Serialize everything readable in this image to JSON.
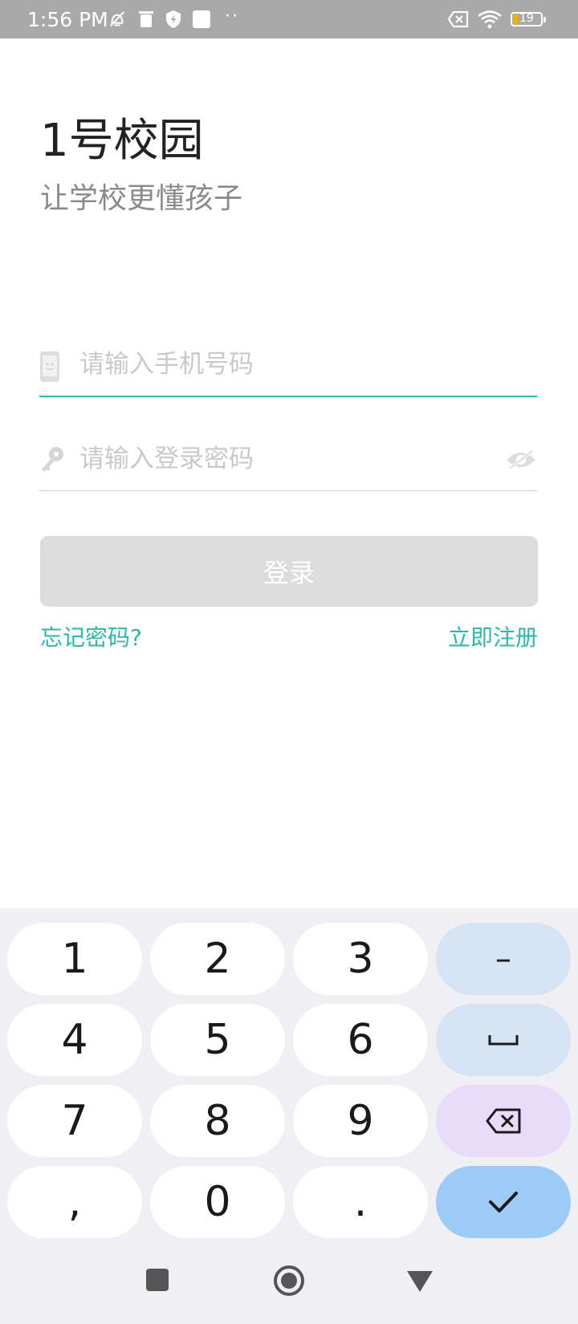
{
  "status_bar": {
    "time": "1:56 PM",
    "battery": "19",
    "icons": [
      "muted-bell-icon",
      "trash-icon",
      "shield-icon",
      "square-icon",
      "more-dots-icon",
      "no-sim-icon",
      "wifi-icon",
      "battery-icon"
    ]
  },
  "app": {
    "title": "1号校园",
    "subtitle": "让学校更懂孩子"
  },
  "form": {
    "phone_placeholder": "请输入手机号码",
    "password_placeholder": "请输入登录密码",
    "login_label": "登录",
    "forgot_label": "忘记密码?",
    "register_label": "立即注册"
  },
  "keyboard": {
    "rows": [
      [
        "1",
        "2",
        "3",
        "–"
      ],
      [
        "4",
        "5",
        "6",
        "␣"
      ],
      [
        "7",
        "8",
        "9",
        "⌫"
      ],
      [
        ",",
        "0",
        ".",
        "✓"
      ]
    ]
  },
  "colors": {
    "accent": "#2bbaa8",
    "statusbar": "#a9a9a9",
    "button_disabled": "#dcdcdc"
  },
  "nav": [
    "recents-square-icon",
    "home-circle-icon",
    "back-triangle-icon"
  ]
}
